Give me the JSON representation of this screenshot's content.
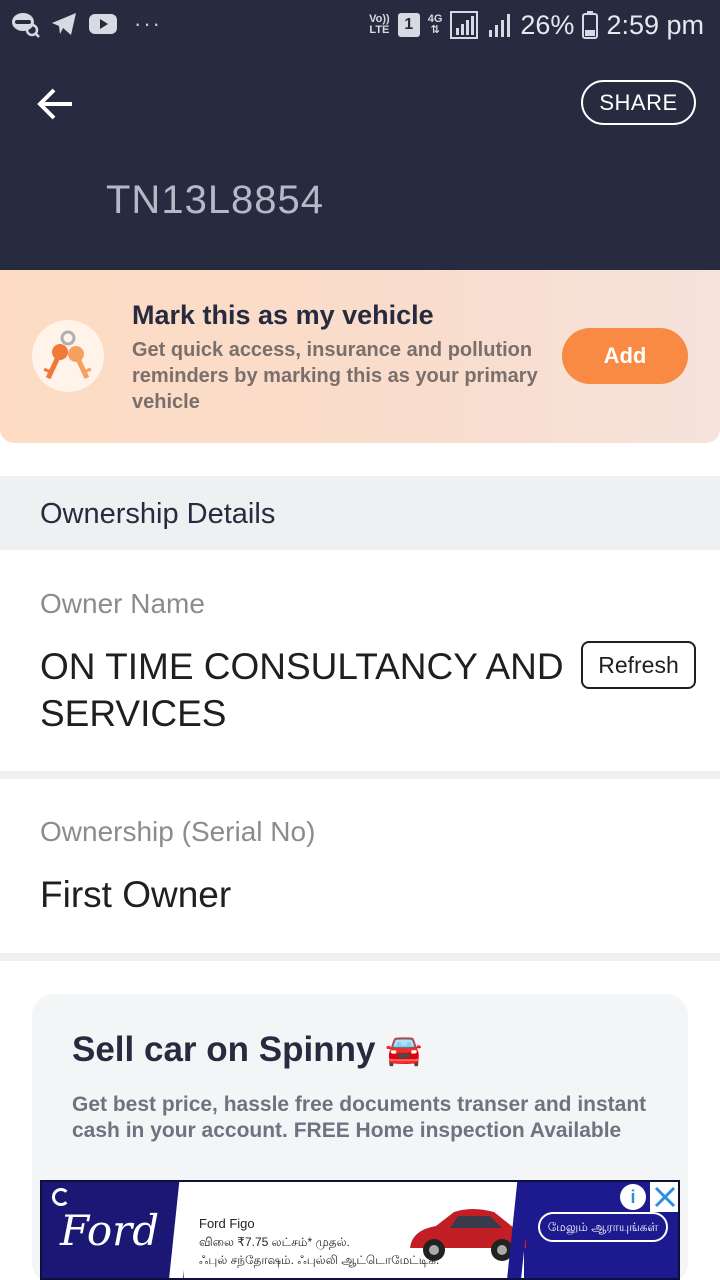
{
  "status_bar": {
    "network_label_1": "Vo))",
    "network_label_2": "LTE",
    "sim_slot": "1",
    "network_type": "4G",
    "battery": "26%",
    "time": "2:59 pm"
  },
  "header": {
    "share_label": "SHARE",
    "plate_number": "TN13L8854"
  },
  "banner": {
    "title": "Mark this as my vehicle",
    "description": "Get quick access, insurance and pollution reminders by marking this as your primary vehicle",
    "add_label": "Add"
  },
  "ownership": {
    "section_title": "Ownership Details",
    "owner_name_label": "Owner Name",
    "owner_name_line1": "ON TIME CONSULTANCY AND",
    "owner_name_line2": "SERVICES",
    "refresh_label": "Refresh",
    "serial_label": "Ownership (Serial No)",
    "serial_value": "First Owner"
  },
  "sell_card": {
    "title": "Sell car on Spinny",
    "car_emoji": "🚘",
    "description": "Get best price, hassle free documents transer and instant cash in your account. FREE Home inspection Available"
  },
  "ad": {
    "brand": "Ford",
    "model": "Ford Figo",
    "price_line": "விலை ₹7.75 லட்சம்* முதல்.",
    "tagline": "ஃபுல் சந்தோஷம். ஃபுல்லி ஆட்டொமேட்டிக்.",
    "cta": "மேலும் ஆராயுங்கள்",
    "info": "i"
  },
  "colors": {
    "header_bg": "#272b3f",
    "accent_orange": "#f98a43",
    "banner_bg": "#fddcc3"
  }
}
